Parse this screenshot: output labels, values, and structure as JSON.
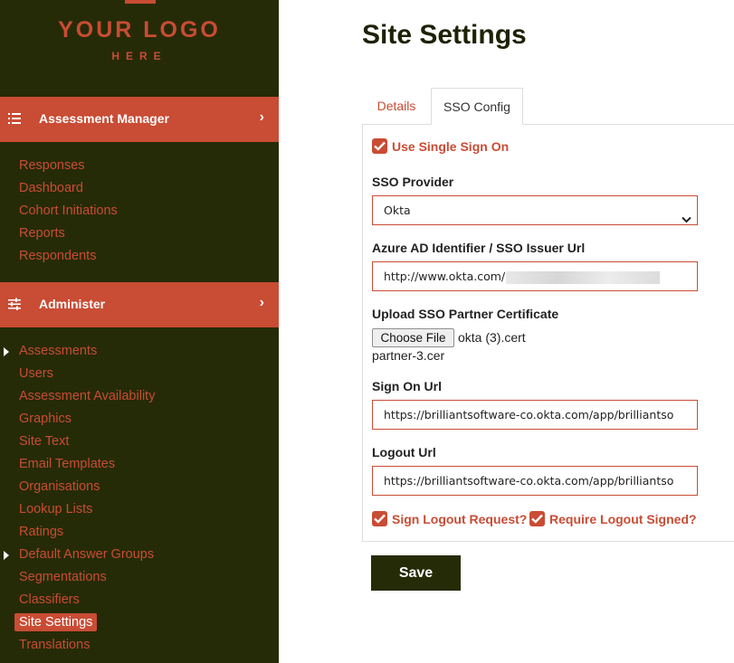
{
  "logo": {
    "title": "YOUR LOGO",
    "subtitle": "HERE"
  },
  "sidebar": {
    "assessment_manager": {
      "label": "Assessment Manager",
      "items": [
        "Responses",
        "Dashboard",
        "Cohort Initiations",
        "Reports",
        "Respondents"
      ]
    },
    "administer": {
      "label": "Administer",
      "items": [
        {
          "label": "Assessments",
          "expandable": true
        },
        {
          "label": "Users"
        },
        {
          "label": "Assessment Availability"
        },
        {
          "label": "Graphics"
        },
        {
          "label": "Site Text"
        },
        {
          "label": "Email Templates"
        },
        {
          "label": "Organisations"
        },
        {
          "label": "Lookup Lists"
        },
        {
          "label": "Ratings"
        },
        {
          "label": "Default Answer Groups",
          "expandable": true
        },
        {
          "label": "Segmentations"
        },
        {
          "label": "Classifiers"
        },
        {
          "label": "Site Settings",
          "active": true
        },
        {
          "label": "Translations"
        }
      ]
    }
  },
  "main": {
    "title": "Site Settings",
    "tabs": [
      {
        "label": "Details",
        "active": false
      },
      {
        "label": "SSO Config",
        "active": true
      }
    ],
    "form": {
      "use_sso": {
        "label": "Use Single Sign On",
        "checked": true
      },
      "provider": {
        "label": "SSO Provider",
        "value": "Okta"
      },
      "issuer": {
        "label": "Azure AD Identifier / SSO Issuer Url",
        "value": "http://www.okta.com/"
      },
      "certificate": {
        "label": "Upload SSO Partner Certificate",
        "button": "Choose File",
        "chosen": "okta (3).cert",
        "current": "partner-3.cer"
      },
      "sign_on": {
        "label": "Sign On Url",
        "value": "https://brilliantsoftware-co.okta.com/app/brilliantso"
      },
      "logout": {
        "label": "Logout Url",
        "value": "https://brilliantsoftware-co.okta.com/app/brilliantso"
      },
      "sign_logout": {
        "label": "Sign Logout Request?",
        "checked": true
      },
      "require_logout": {
        "label": "Require Logout Signed?",
        "checked": true
      }
    },
    "save_label": "Save"
  },
  "colors": {
    "accent": "#c94c34",
    "sidebar_bg": "#262b07",
    "text_dark": "#1d2205"
  }
}
